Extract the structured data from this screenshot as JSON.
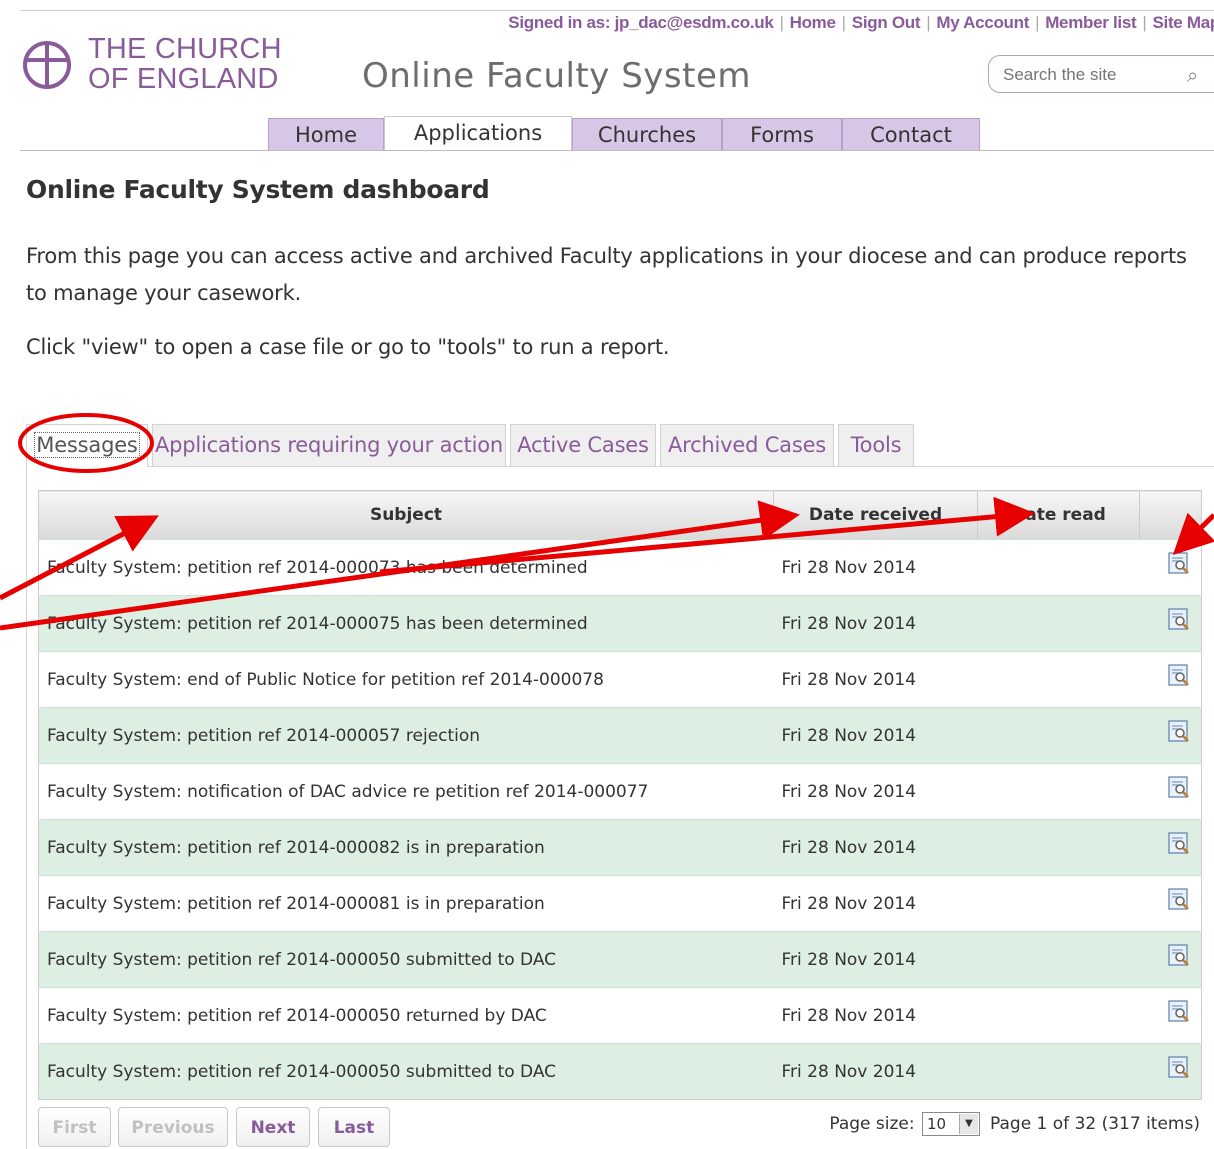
{
  "topbar": {
    "signed_in": "Signed in as: jp_dac@esdm.co.uk",
    "links": [
      "Home",
      "Sign Out",
      "My Account",
      "Member list",
      "Site Map"
    ]
  },
  "logo": {
    "line1": "THE CHURCH",
    "line2": "OF ENGLAND"
  },
  "site_title": "Online Faculty System",
  "search": {
    "placeholder": "Search the site",
    "icon": "search-icon"
  },
  "nav": {
    "tabs": [
      "Home",
      "Applications",
      "Churches",
      "Forms",
      "Contact"
    ],
    "active": "Applications"
  },
  "page": {
    "heading": "Online Faculty System dashboard",
    "intro": "From this page you can access active and archived Faculty applications in your diocese and can produce reports to manage your casework.",
    "instruction": "Click \"view\" to open a case file or go to \"tools\" to run a report."
  },
  "content_tabs": [
    "Messages",
    "Applications requiring your action",
    "Active Cases",
    "Archived Cases",
    "Tools"
  ],
  "active_content_tab": "Messages",
  "table": {
    "columns": [
      "Subject",
      "Date received",
      "Date read",
      ""
    ],
    "rows": [
      {
        "subject": "Faculty System: petition ref 2014-000073 has been determined",
        "received": "Fri 28 Nov 2014",
        "read": ""
      },
      {
        "subject": "Faculty System: petition ref 2014-000075 has been determined",
        "received": "Fri 28 Nov 2014",
        "read": ""
      },
      {
        "subject": "Faculty System: end of Public Notice for petition ref 2014-000078",
        "received": "Fri 28 Nov 2014",
        "read": ""
      },
      {
        "subject": "Faculty System: petition ref 2014-000057 rejection",
        "received": "Fri 28 Nov 2014",
        "read": ""
      },
      {
        "subject": "Faculty System: notification of DAC advice re petition ref 2014-000077",
        "received": "Fri 28 Nov 2014",
        "read": ""
      },
      {
        "subject": "Faculty System: petition ref 2014-000082 is in preparation",
        "received": "Fri 28 Nov 2014",
        "read": ""
      },
      {
        "subject": "Faculty System: petition ref 2014-000081 is in preparation",
        "received": "Fri 28 Nov 2014",
        "read": ""
      },
      {
        "subject": "Faculty System: petition ref 2014-000050 submitted to DAC",
        "received": "Fri 28 Nov 2014",
        "read": ""
      },
      {
        "subject": "Faculty System: petition ref 2014-000050 returned by DAC",
        "received": "Fri 28 Nov 2014",
        "read": ""
      },
      {
        "subject": "Faculty System: petition ref 2014-000050 submitted to DAC",
        "received": "Fri 28 Nov 2014",
        "read": ""
      }
    ]
  },
  "pager": {
    "first": "First",
    "previous": "Previous",
    "next": "Next",
    "last": "Last",
    "page_size_label": "Page size:",
    "page_size": "10",
    "page_info": "Page 1 of 32 (317 items)"
  },
  "colors": {
    "brand": "#8a5b9a",
    "tab_bg": "#d8c6e6",
    "row_alt": "#ddeee3",
    "annotation": "#e60000"
  }
}
